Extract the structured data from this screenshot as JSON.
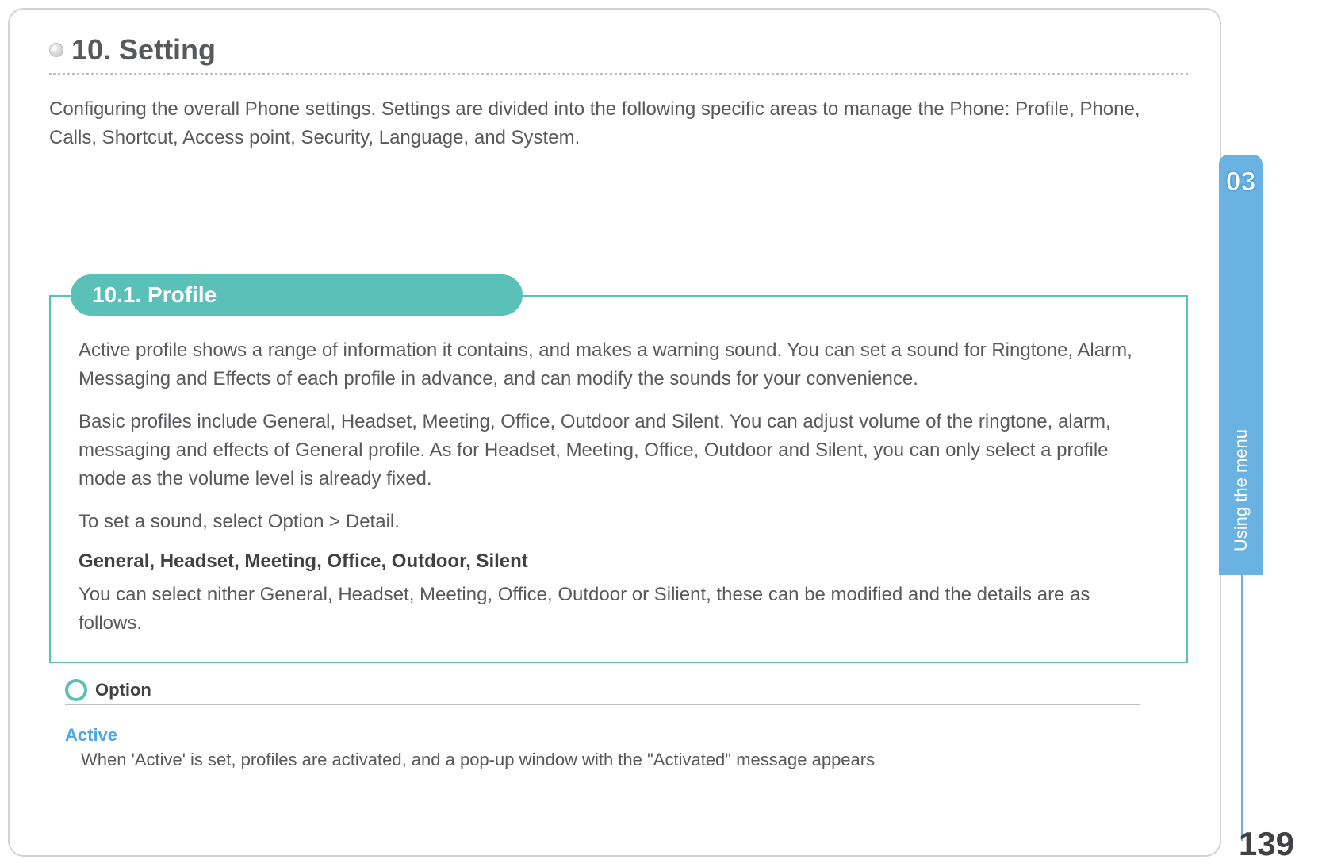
{
  "heading": "10. Setting",
  "intro": "Configuring the overall Phone settings. Settings are divided into the following specific areas to manage the Phone: Profile, Phone, Calls, Shortcut, Access point, Security, Language, and System.",
  "section": {
    "label": "10.1. Profile",
    "body1": "Active profile shows a range of information it contains, and makes a warning sound. You can set a sound for Ringtone, Alarm, Messaging and Effects of each profile in advance, and can modify the sounds for your convenience.",
    "body2": "Basic profiles include General, Headset, Meeting, Office, Outdoor and Silent. You can adjust volume of the ringtone, alarm, messaging and effects of General profile. As for Headset, Meeting, Office, Outdoor and Silent, you can only select a profile mode as the volume level is already fixed.",
    "body3": "To set a sound, select Option > Detail.",
    "profiles_heading": "General, Headset, Meeting, Office, Outdoor, Silent",
    "body4": "You can select nither General, Headset, Meeting, Office, Outdoor or Silient, these can be modified and the details are as follows."
  },
  "option": {
    "label": "Option",
    "active_heading": "Active",
    "active_desc": "When 'Active' is set, profiles are activated, and a pop-up window with the \"Activated\" message appears"
  },
  "side": {
    "number": "03",
    "label": "Using the menu"
  },
  "page_number": "139"
}
